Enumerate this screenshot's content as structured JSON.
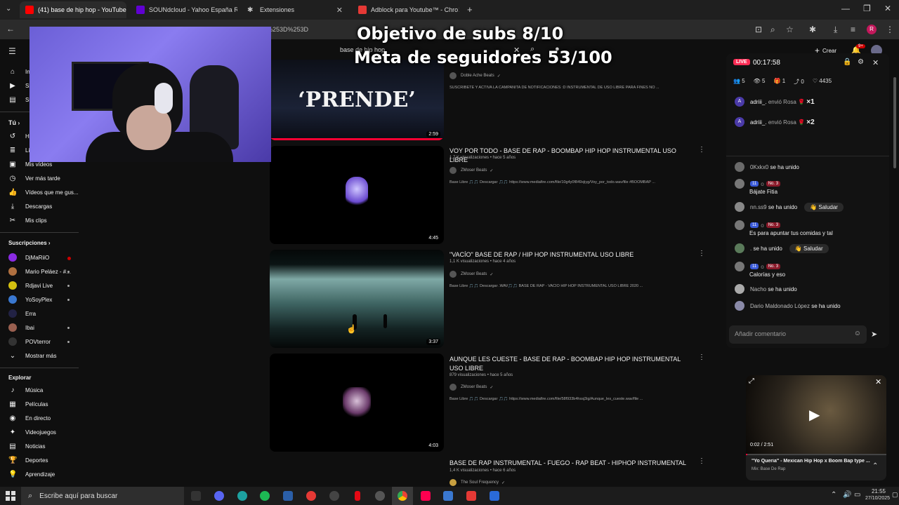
{
  "browser": {
    "tabs": [
      {
        "label": "(41) base de hip hop - YouTube",
        "icon": "youtube-icon",
        "color": "#ff0000"
      },
      {
        "label": "SOUNdcloud - Yahoo España R",
        "icon": "yahoo-icon",
        "color": "#6001d2"
      },
      {
        "label": "Extensiones",
        "icon": "puzzle-icon",
        "color": "#cccccc"
      },
      {
        "label": "Adblock para Youtube™ - Chro",
        "icon": "adblock-icon",
        "color": "#e53935"
      }
    ],
    "url_fragment": "%253D%253D",
    "profile_initial": "R"
  },
  "overlay": {
    "line1": "Objetivo de subs 8/10",
    "line2": "Meta de seguidores 53/100"
  },
  "search": {
    "query": "base de hip hop"
  },
  "header": {
    "create_label": "Crear",
    "notif_badge": "9+"
  },
  "sidebar": {
    "top_items": [
      {
        "label": "In",
        "icon": "home-icon"
      },
      {
        "label": "Sh",
        "icon": "shorts-icon"
      },
      {
        "label": "Su",
        "icon": "subscriptions-icon"
      }
    ],
    "you_header": "Tú",
    "you_items": [
      {
        "label": "Hi",
        "icon": "history-icon"
      },
      {
        "label": "Li",
        "icon": "playlist-icon"
      },
      {
        "label": "Mis vídeos",
        "icon": "video-icon"
      },
      {
        "label": "Ver más tarde",
        "icon": "clock-icon"
      },
      {
        "label": "Vídeos que me gus...",
        "icon": "like-icon"
      },
      {
        "label": "Descargas",
        "icon": "download-icon"
      },
      {
        "label": "Mis clips",
        "icon": "scissors-icon"
      }
    ],
    "subs_header": "Suscripciones",
    "subscriptions": [
      {
        "label": "DjMaRiiO",
        "color": "#8a2be2"
      },
      {
        "label": "Mario Peláez - #...",
        "color": "#b07040"
      },
      {
        "label": "Rdjavi Live",
        "color": "#d4c010"
      },
      {
        "label": "YoSoyPlex",
        "color": "#3a78d0"
      },
      {
        "label": "Erra",
        "color": "#222244"
      },
      {
        "label": "Ibai",
        "color": "#9a6050"
      },
      {
        "label": "POVterror",
        "color": "#333333"
      }
    ],
    "show_more": "Mostrar más",
    "explore_header": "Explorar",
    "explore_items": [
      {
        "label": "Música",
        "icon": "music-icon"
      },
      {
        "label": "Películas",
        "icon": "film-icon"
      },
      {
        "label": "En directo",
        "icon": "live-icon"
      },
      {
        "label": "Videojuegos",
        "icon": "gamepad-icon"
      },
      {
        "label": "Noticias",
        "icon": "news-icon"
      },
      {
        "label": "Deportes",
        "icon": "trophy-icon"
      },
      {
        "label": "Aprendizaje",
        "icon": "bulb-icon"
      }
    ]
  },
  "results": [
    {
      "thumb_text": "‘PRENDE’",
      "duration": "2:59",
      "title": "",
      "meta": "",
      "channel": "Doble Ache Beats",
      "desc": "SUSCRIBETE Y ACTIVA LA CAMPANITA DE NOTIFICACIONES :D INSTRUMENTAL DE USO LIBRE PARA FINES NO ..."
    },
    {
      "duration": "4:45",
      "title": "VOY POR TODO - BASE DE RAP - BOOMBAP HIP HOP INSTRUMENTAL USO LIBRE",
      "meta": "1,7 K visualizaciones • hace 5 años",
      "channel": "ZMoser Beats",
      "desc": "Base Libre 🎵🎵 Descargar 🎵🎵 https://www.mediafire.com/file/10g4y0f849xjiyg/Voy_por_todo.wav/file #BOOMBAP ..."
    },
    {
      "duration": "3:37",
      "title": "\"VACÍO\" BASE DE RAP / HIP HOP INSTRUMENTAL USO LIBRE",
      "meta": "1,1 K visualizaciones • hace 4 años",
      "channel": "ZMoser Beats",
      "desc": "Base Libre 🎵🎵 Descargar .WAV🎵🎵 BASE DE RAP - VACÍO HIP HOP INSTRUMENTAL USO LIBRE 2020 ..."
    },
    {
      "duration": "4:03",
      "title": "AUNQUE LES CUESTE - BASE DE RAP - BOOMBAP HIP HOP INSTRUMENTAL USO LIBRE",
      "meta": "879 visualizaciones • hace 5 años",
      "channel": "ZMoser Beats",
      "desc": "Base Libre 🎵🎵 Descargar 🎵🎵 https://www.mediafire.com/file/58f933b4hssj3ig/Aunque_les_cueste.wav/file ..."
    },
    {
      "duration": "",
      "title": "BASE DE RAP INSTRUMENTAL - FUEGO - RAP BEAT - HIPHOP INSTRUMENTAL",
      "meta": "1,4 K visualizaciones • hace 6 años",
      "channel": "The Soul Frequency",
      "desc": ""
    }
  ],
  "live": {
    "live_label": "LIVE",
    "timer": "00:17:58",
    "stats": {
      "users": "5",
      "views": "5",
      "gifts": "1",
      "shares": "0",
      "likes": "4435"
    },
    "gift_events": [
      {
        "user": "adriii_.",
        "text": "envió Rosa",
        "count": "×1"
      },
      {
        "user": "adriii_.",
        "text": "envió Rosa",
        "count": "×2"
      }
    ],
    "chat": [
      {
        "user": "0Kxkx0",
        "text": "se ha unido",
        "badges": [],
        "greet": ""
      },
      {
        "user": "",
        "badges": [
          "11",
          "No. 3"
        ],
        "text": "Bájate Fitia",
        "greet": ""
      },
      {
        "user": "nn.ss9",
        "text": "se ha unido",
        "badges": [],
        "greet": "Saludar"
      },
      {
        "user": "",
        "badges": [
          "11",
          "No. 3"
        ],
        "text": "Es para apuntar tus comidas y tal",
        "greet": ""
      },
      {
        "user": ".",
        "text": "se ha unido",
        "badges": [],
        "greet": "Saludar"
      },
      {
        "user": "",
        "badges": [
          "11",
          "No. 3"
        ],
        "text": "Calorías y eso",
        "greet": ""
      },
      {
        "user": "Nacho",
        "text": "se ha unido",
        "badges": [],
        "greet": ""
      },
      {
        "user": "Dario Maldonado López",
        "text": "se ha unido",
        "badges": [],
        "greet": ""
      }
    ],
    "comment_placeholder": "Añadir comentario"
  },
  "mini_player": {
    "time": "0:02 / 2:51",
    "title": "\"Yo Queria\" - Mexican Hip Hop x Boom Bap type ...",
    "subtitle": "Mix: Base De Rap",
    "progress": 0.012
  },
  "taskbar": {
    "search_placeholder": "Escribe aquí para buscar",
    "time": "21:55",
    "date": "27/10/2025",
    "apps": [
      {
        "name": "epic-games-icon",
        "color": "#333"
      },
      {
        "name": "discord-icon",
        "color": "#5865f2"
      },
      {
        "name": "edge-icon",
        "color": "#1da1a0"
      },
      {
        "name": "spotify-icon",
        "color": "#1db954"
      },
      {
        "name": "calculator-icon",
        "color": "#2b5fa8"
      },
      {
        "name": "media-icon",
        "color": "#e53935"
      },
      {
        "name": "obs-icon",
        "color": "#444"
      },
      {
        "name": "netflix-icon",
        "color": "#e50914"
      },
      {
        "name": "steam-icon",
        "color": "#555"
      },
      {
        "name": "chrome-icon",
        "color": "#4285f4"
      },
      {
        "name": "tiktok-icon",
        "color": "#ff0050"
      },
      {
        "name": "store-icon",
        "color": "#3a78d0"
      },
      {
        "name": "security-icon",
        "color": "#e53935"
      },
      {
        "name": "defender-icon",
        "color": "#2a6ad8"
      }
    ]
  }
}
